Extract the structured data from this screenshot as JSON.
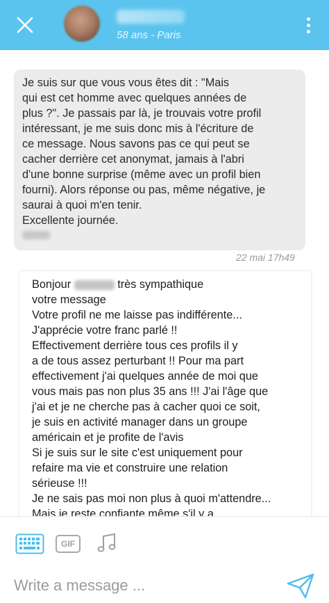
{
  "header": {
    "name_blurred": "",
    "subtitle": "58 ans - Paris",
    "accent_color": "#5bc4ee"
  },
  "messages": {
    "incoming": {
      "text": "Je suis sur que vous vous êtes dit  : \"Mais\nqui est cet homme avec quelques années de\nplus ?\". Je passais par là, je trouvais votre profil\nintéressant, je me suis donc mis à l'écriture de\nce message. Nous savons pas ce qui peut se\ncacher derrière cet anonymat, jamais à l'abri\nd'une bonne surprise (même avec un profil bien\nfourni). Alors réponse ou pas, même négative, je\nsaurai à quoi m'en tenir.\nExcellente journée.",
      "timestamp": "22 mai 17h49"
    },
    "outgoing": {
      "greeting": "Bonjour",
      "greeting_rest": "très sympathique",
      "lines": [
        "votre message",
        "Votre profil ne me laisse pas indifférente...",
        "J'apprécie votre franc parlé !!",
        "Effectivement derrière tous ces profils il y",
        "a de tous assez perturbant !! Pour ma part",
        "effectivement j'ai quelques année de moi que",
        "vous mais pas non plus 35 ans !!! J'ai l'âge que",
        "j'ai et je ne cherche pas à cacher quoi ce soit,",
        "je suis en activité manager dans un groupe",
        "américain et je profite de l'avis",
        "Si je suis sur le site c'est uniquement pour",
        "refaire ma vie et construire une relation",
        "sérieuse !!!",
        "Je ne sais pas moi non plus à quoi m'attendre...",
        "Mais je reste confiante même s'il y a"
      ]
    }
  },
  "toolbar": {
    "keyboard_icon": "keyboard-icon",
    "gif_label": "GIF",
    "music_icon": "music-note-icon"
  },
  "composer": {
    "placeholder": "Write a message ...",
    "send_icon": "send-icon"
  }
}
